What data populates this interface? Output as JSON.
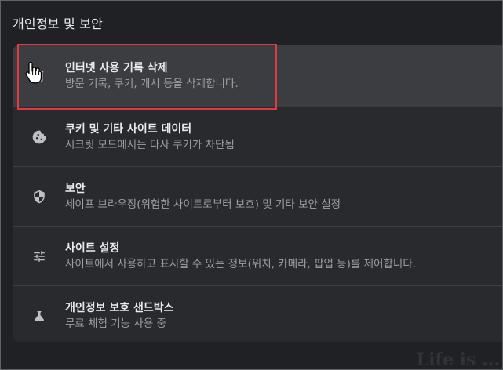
{
  "section": {
    "title": "개인정보 및 보안"
  },
  "items": [
    {
      "icon": "trash-icon",
      "title": "인터넷 사용 기록 삭제",
      "subtitle": "방문 기록, 쿠키, 캐시 등을 삭제합니다."
    },
    {
      "icon": "cookie-icon",
      "title": "쿠키 및 기타 사이트 데이터",
      "subtitle": "시크릿 모드에서는 타사 쿠키가 차단됨"
    },
    {
      "icon": "shield-icon",
      "title": "보안",
      "subtitle": "세이프 브라우징(위험한 사이트로부터 보호) 및 기타 보안 설정"
    },
    {
      "icon": "tune-icon",
      "title": "사이트 설정",
      "subtitle": "사이트에서 사용하고 표시할 수 있는 정보(위치, 카메라, 팝업 등)를 제어합니다."
    },
    {
      "icon": "flask-icon",
      "title": "개인정보 보호 샌드박스",
      "subtitle": "무료 체험 기능 사용 중"
    }
  ],
  "colors": {
    "background": "#202124",
    "card": "#292a2d",
    "hover_row": "#3c3d40",
    "highlight_border": "#e03a3e",
    "title_text": "#e8eaed",
    "subtitle_text": "#9aa0a6"
  },
  "watermark": {
    "text": "Life is ..."
  }
}
